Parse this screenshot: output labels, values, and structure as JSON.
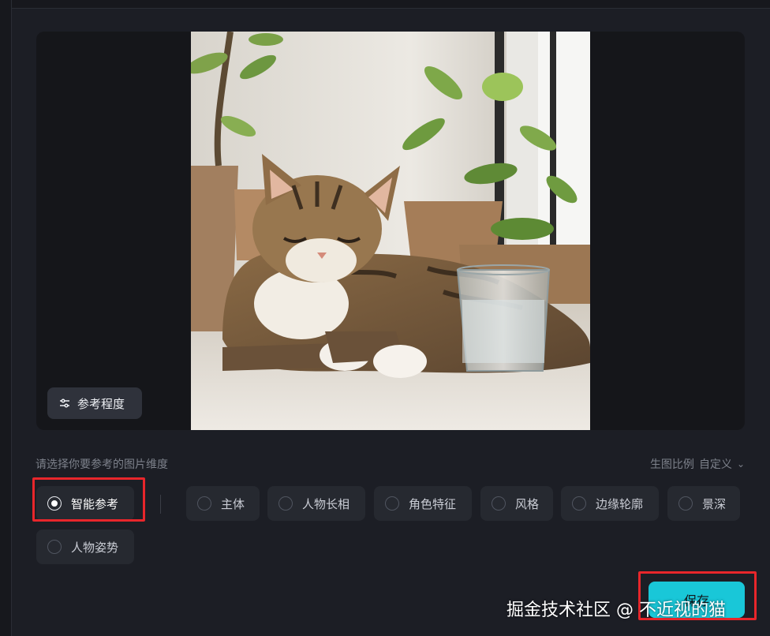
{
  "preview": {
    "reference_button_label": "参考程度"
  },
  "options": {
    "hint": "请选择你要参考的图片维度",
    "ratio_label": "生图比例",
    "ratio_value": "自定义",
    "items": [
      {
        "label": "智能参考",
        "selected": true
      },
      {
        "label": "主体",
        "selected": false
      },
      {
        "label": "人物长相",
        "selected": false
      },
      {
        "label": "角色特征",
        "selected": false
      },
      {
        "label": "风格",
        "selected": false
      },
      {
        "label": "边缘轮廓",
        "selected": false
      },
      {
        "label": "景深",
        "selected": false
      },
      {
        "label": "人物姿势",
        "selected": false
      }
    ]
  },
  "footer": {
    "save_label": "保存",
    "watermark": "掘金技术社区 @ 不近视的猫"
  },
  "colors": {
    "accent": "#19c7d8",
    "highlight": "#e8262b",
    "background": "#1c1e25"
  }
}
